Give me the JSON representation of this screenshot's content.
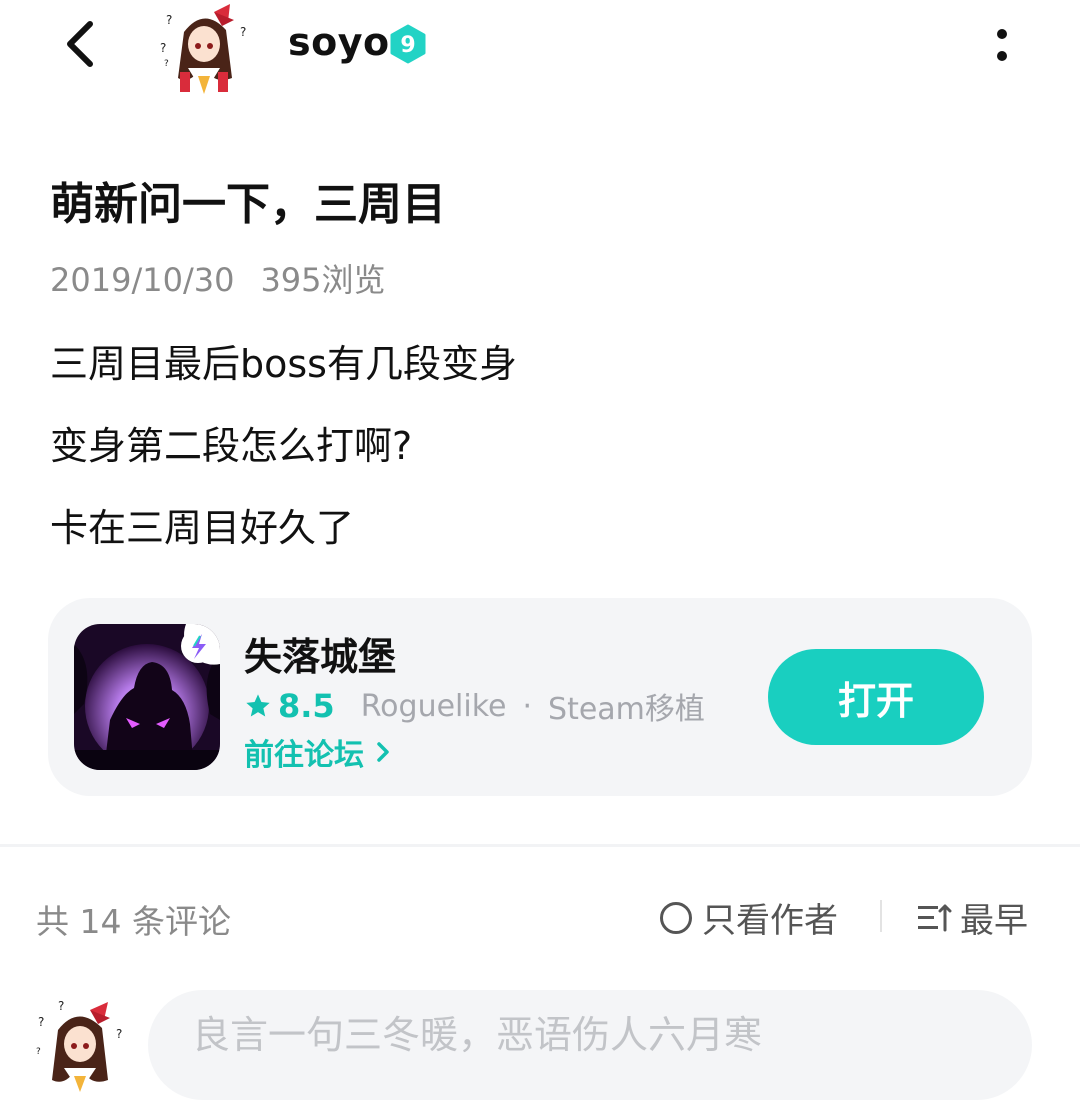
{
  "header": {
    "username": "soyo",
    "level": "9",
    "back_icon": "chevron-left-icon",
    "more_icon": "more-vertical-icon"
  },
  "post": {
    "title": "萌新问一下，三周目",
    "date": "2019/10/30",
    "views": "395浏览",
    "lines": [
      "三周目最后boss有几段变身",
      "变身第二段怎么打啊?",
      "卡在三周目好久了"
    ]
  },
  "game_card": {
    "name": "失落城堡",
    "rating": "8.5",
    "genre": "Roguelike",
    "separator": "·",
    "tag": "Steam移植",
    "forum_link": "前往论坛",
    "open_label": "打开"
  },
  "comments": {
    "count_label": "共 14 条评论",
    "author_only_label": "只看作者",
    "sort_label": "最早"
  },
  "comment_input": {
    "placeholder": "良言一句三冬暖，恶语伤人六月寒"
  },
  "colors": {
    "accent": "#19cfc0",
    "accent_text": "#13c1b0",
    "card_bg": "#f4f5f7",
    "muted_text": "#8a8a8a"
  }
}
